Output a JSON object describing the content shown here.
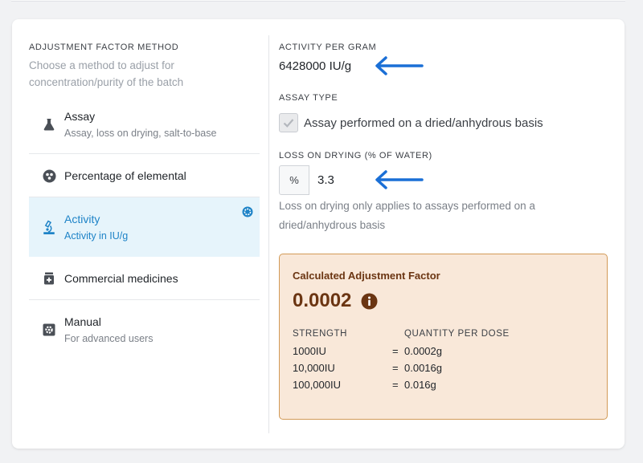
{
  "method_panel": {
    "title": "ADJUSTMENT FACTOR METHOD",
    "description": "Choose a method to adjust for concentration/purity of the batch",
    "methods": [
      {
        "label": "Assay",
        "sub": "Assay, loss on drying, salt-to-base",
        "icon": "flask-icon"
      },
      {
        "label": "Percentage of elemental",
        "sub": "",
        "icon": "atom-icon"
      },
      {
        "label": "Activity",
        "sub": "Activity in IU/g",
        "icon": "microscope-icon"
      },
      {
        "label": "Commercial medicines",
        "sub": "",
        "icon": "medicine-bottle-icon"
      },
      {
        "label": "Manual",
        "sub": "For advanced users",
        "icon": "gear-icon"
      }
    ],
    "selected_index": 2
  },
  "activity": {
    "title": "ACTIVITY PER GRAM",
    "value": "6428000 IU/g"
  },
  "assay_type": {
    "title": "ASSAY TYPE",
    "checkbox_label": "Assay performed on a dried/anhydrous basis",
    "checked": true
  },
  "loss_on_drying": {
    "title": "LOSS ON DRYING (% OF WATER)",
    "prefix": "%",
    "value": "3.3",
    "help": "Loss on drying only applies to assays performed on a dried/anhydrous basis"
  },
  "result": {
    "title": "Calculated Adjustment Factor",
    "value": "0.0002",
    "headers": {
      "strength": "STRENGTH",
      "quantity": "QUANTITY PER DOSE"
    },
    "rows": [
      {
        "strength": "1000IU",
        "eq": "=",
        "quantity": "0.0002g"
      },
      {
        "strength": "10,000IU",
        "eq": "=",
        "quantity": "0.0016g"
      },
      {
        "strength": "100,000IU",
        "eq": "=",
        "quantity": "0.016g"
      }
    ]
  },
  "colors": {
    "accent": "#1e83c7",
    "arrow": "#1a6fd6",
    "result_bg": "#f9e8d9",
    "result_border": "#d29a57",
    "result_text": "#6b3512"
  }
}
